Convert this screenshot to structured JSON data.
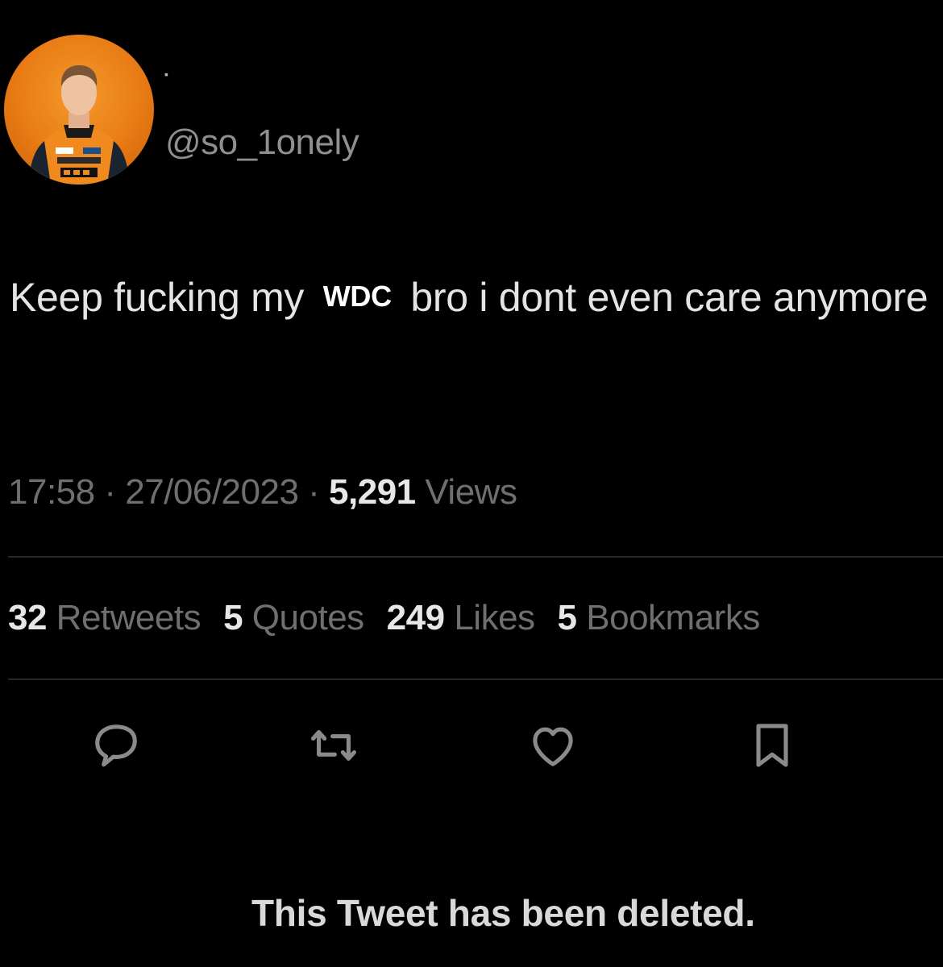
{
  "profile": {
    "avatar_icon": "driver-avatar",
    "handle": "@so_1onely"
  },
  "tweet": {
    "text_before": "Keep fucking my ",
    "censor_label": "WDC",
    "text_after": " bro i dont even care anymore"
  },
  "meta": {
    "time": "17:58",
    "separator1": " · ",
    "date": "27/06/2023",
    "separator2": " · ",
    "views_count": "5,291",
    "views_label": " Views"
  },
  "stats": [
    {
      "count": "32",
      "label": " Retweets"
    },
    {
      "count": "5",
      "label": " Quotes"
    },
    {
      "count": "249",
      "label": " Likes"
    },
    {
      "count": "5",
      "label": " Bookmarks"
    }
  ],
  "actions": [
    "reply-icon",
    "retweet-icon",
    "heart-icon",
    "bookmark-icon"
  ],
  "status": {
    "deleted_text": "This Tweet has been deleted."
  },
  "colors": {
    "background": "#000000",
    "avatar_orange": "#e87a14",
    "muted_text": "#6f6f6f",
    "primary_text": "#e7e7e7"
  }
}
